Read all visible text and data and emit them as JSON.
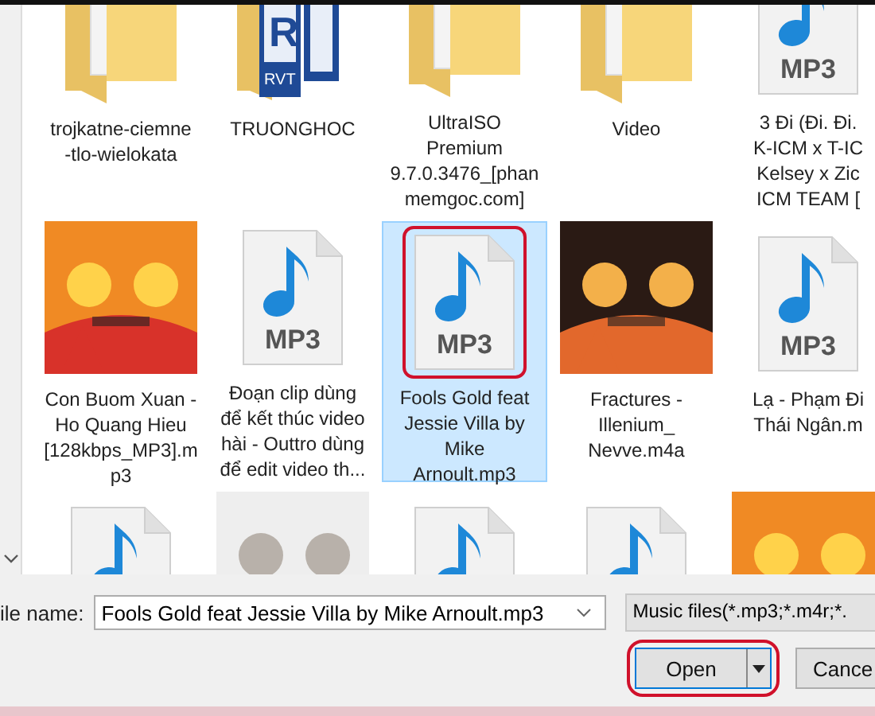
{
  "items": [
    {
      "kind": "folder",
      "label": "trojkatne-ciemne\n-tlo-wielokata",
      "selected": false,
      "annotated": false
    },
    {
      "kind": "revit",
      "label": "TRUONGHOC",
      "mark": "R",
      "badge": "RVT",
      "selected": false,
      "annotated": false
    },
    {
      "kind": "folder",
      "label": "UltraISO\nPremium\n9.7.0.3476_[phan\nmemgoc.com]",
      "selected": false,
      "annotated": false
    },
    {
      "kind": "folder",
      "label": "Video",
      "selected": false,
      "annotated": false
    },
    {
      "kind": "mp3",
      "badge": "MP3",
      "label": "3 Đi (Đi. Đi.\nK-ICM x T-IC\nKelsey x Zic\nICM TEAM [",
      "selected": false,
      "annotated": false
    },
    {
      "kind": "picture",
      "label": "Con Buom Xuan -\nHo Quang Hieu\n[128kbps_MP3].m\np3",
      "selected": false,
      "annotated": false
    },
    {
      "kind": "mp3",
      "badge": "MP3",
      "label": "Đoạn clip dùng\nđể kết thúc video\nhài - Outtro dùng\nđể edit video th...",
      "selected": false,
      "annotated": false
    },
    {
      "kind": "mp3",
      "badge": "MP3",
      "label": "Fools Gold feat\nJessie Villa by\nMike\nArnoult.mp3",
      "selected": true,
      "annotated": true
    },
    {
      "kind": "picture",
      "label": "Fractures -\nIllenium_\nNevve.m4a",
      "selected": false,
      "annotated": false
    },
    {
      "kind": "mp3",
      "badge": "MP3",
      "label": "Lạ - Phạm Đi\nThái Ngân.m",
      "selected": false,
      "annotated": false
    },
    {
      "kind": "mp3",
      "selected": false,
      "annotated": false
    },
    {
      "kind": "picture",
      "selected": false,
      "annotated": false
    },
    {
      "kind": "mp3",
      "selected": false,
      "annotated": false
    },
    {
      "kind": "mp3",
      "selected": false,
      "annotated": false
    },
    {
      "kind": "picture",
      "selected": false,
      "annotated": false
    }
  ],
  "file_name": {
    "label": "ile name:",
    "value": "Fools Gold feat Jessie Villa by Mike Arnoult.mp3"
  },
  "file_type": {
    "value": "Music files(*.mp3;*.m4r;*."
  },
  "buttons": [
    {
      "kind": "split",
      "label": "Open",
      "annotated": true
    },
    {
      "kind": "plain",
      "label": "Cance"
    }
  ]
}
